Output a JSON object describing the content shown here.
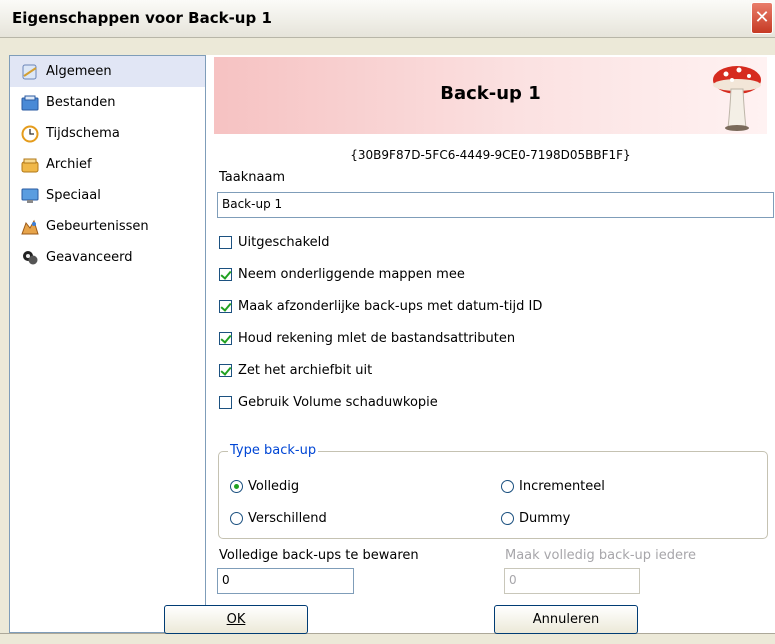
{
  "window": {
    "title": "Eigenschappen voor Back-up 1",
    "close_glyph": "✕"
  },
  "nav": {
    "items": [
      {
        "label": "Algemeen",
        "icon": "general-icon"
      },
      {
        "label": "Bestanden",
        "icon": "files-icon"
      },
      {
        "label": "Tijdschema",
        "icon": "clock-icon"
      },
      {
        "label": "Archief",
        "icon": "archive-icon"
      },
      {
        "label": "Speciaal",
        "icon": "monitor-icon"
      },
      {
        "label": "Gebeurtenissen",
        "icon": "events-icon"
      },
      {
        "label": "Geavanceerd",
        "icon": "advanced-icon"
      }
    ],
    "selected": "Algemeen"
  },
  "header": {
    "title": "Back-up 1",
    "guid": "{30B9F87D-5FC6-4449-9CE0-7198D05BBF1F}",
    "image": "mushroom-icon"
  },
  "form": {
    "task_name_label": "Taaknaam",
    "task_name_value": "Back-up 1",
    "checkboxes": [
      {
        "label": "Uitgeschakeld",
        "checked": false
      },
      {
        "label": "Neem onderliggende mappen mee",
        "checked": true
      },
      {
        "label": "Maak afzonderlijke back-ups met datum-tijd ID",
        "checked": true
      },
      {
        "label": "Houd rekening mlet de bastandsattributen",
        "checked": true
      },
      {
        "label": "Zet het archiefbit uit",
        "checked": true
      },
      {
        "label": "Gebruik Volume schaduwkopie",
        "checked": false
      }
    ],
    "backup_type": {
      "legend": "Type back-up",
      "options": [
        "Volledig",
        "Incrementeel",
        "Verschillend",
        "Dummy"
      ],
      "selected": "Volledig"
    },
    "keep_full_label": "Volledige back-ups te bewaren",
    "keep_full_value": "0",
    "full_every_label": "Maak volledig back-up iedere",
    "full_every_value": "0"
  },
  "buttons": {
    "ok": "OK",
    "cancel": "Annuleren"
  },
  "colors": {
    "accent_blue": "#0046d5",
    "check_green": "#21a121",
    "banner_pink": "#f6c2c2"
  }
}
